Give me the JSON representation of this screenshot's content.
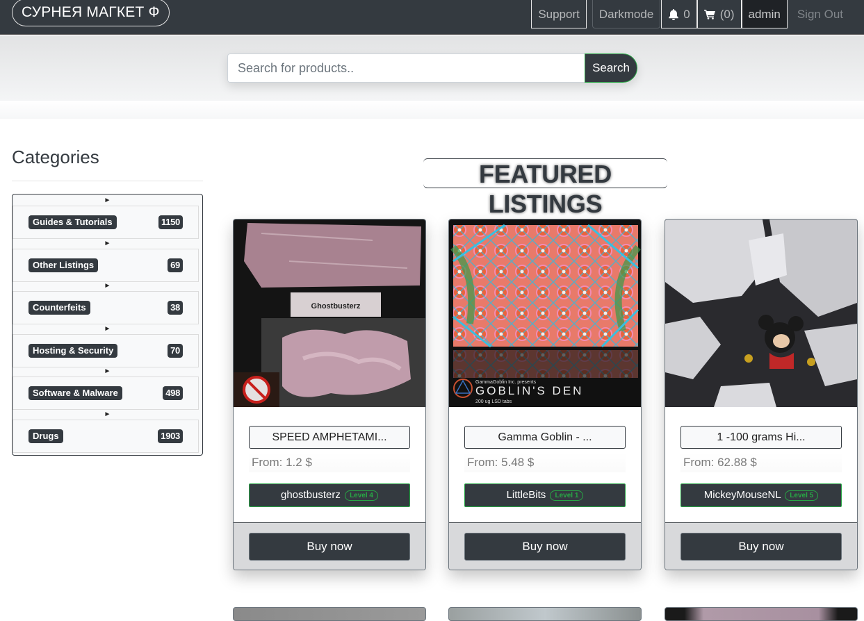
{
  "navbar": {
    "brand": "СУРНЕЯ МАГКЕТ Ф",
    "support": "Support",
    "darkmode": "Darkmode",
    "notifications_icon": "bell-icon",
    "notifications_count": "0",
    "cart_icon": "cart-icon",
    "cart_count": "(0)",
    "user": "admin",
    "signout": "Sign Out"
  },
  "search": {
    "placeholder": "Search for products..",
    "value": "",
    "button": "Search"
  },
  "sidebar": {
    "title": "Categories",
    "expand_icon": "triangle-right-icon",
    "categories": [
      {
        "label": "Guides & Tutorials",
        "count": "1150"
      },
      {
        "label": "Other Listings",
        "count": "69"
      },
      {
        "label": "Counterfeits",
        "count": "38"
      },
      {
        "label": "Hosting & Security",
        "count": "70"
      },
      {
        "label": "Software & Malware",
        "count": "498"
      },
      {
        "label": "Drugs",
        "count": "1903"
      }
    ]
  },
  "featured": {
    "title": "FEATURED LISTINGS",
    "listings": [
      {
        "title": "SPEED AMPHETAMI...",
        "price": "From: 1.2 $",
        "vendor": "ghostbusterz",
        "level": "Level 4",
        "buy": "Buy now",
        "image_alt": "product photo with Ghostbusterz label",
        "image_label": "Ghostbusterz"
      },
      {
        "title": "Gamma Goblin - ...",
        "price": "From: 5.48 $",
        "vendor": "LittleBits",
        "level": "Level 1",
        "buy": "Buy now",
        "image_alt": "psychedelic blotter art",
        "image_small": "GammaGoblin Inc. presents",
        "image_label": "GOBLIN'S DEN",
        "image_sub": "200 ug LSD tabs"
      },
      {
        "title": "1 -100 grams Hi...",
        "price": "From: 62.88 $",
        "vendor": "MickeyMouseNL",
        "level": "Level 5",
        "buy": "Buy now",
        "image_alt": "white crystalline product with cartoon mouse print"
      }
    ]
  },
  "colors": {
    "navbar_bg": "#343a40",
    "accent_green": "#28a745",
    "dark": "#343a40"
  }
}
